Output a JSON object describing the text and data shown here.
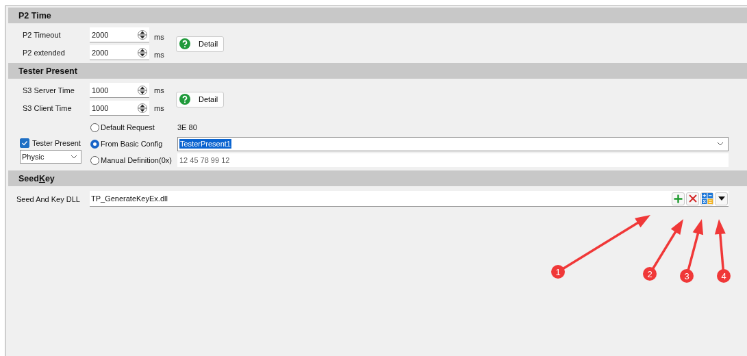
{
  "sections": [
    {
      "title": [
        {
          "text": "P2 Time",
          "underline": false
        }
      ],
      "kind": "timing",
      "rows": [
        {
          "label": "P2 Timeout",
          "value": "2000",
          "unit": "ms"
        },
        {
          "label": "P2 extended",
          "value": "2000",
          "unit": "ms"
        }
      ],
      "detail_button": "Detail"
    },
    {
      "title": [
        {
          "text": "Tester Present",
          "underline": false
        }
      ],
      "kind": "tester",
      "rows": [
        {
          "label": "S3 Server Time",
          "value": "1000",
          "unit": "ms"
        },
        {
          "label": "S3 Client Time",
          "value": "1000",
          "unit": "ms"
        }
      ],
      "detail_button": "Detail",
      "tester_present": {
        "label": "Tester Present",
        "checked": true
      },
      "addressing": {
        "value": "Physic"
      },
      "options": [
        {
          "label": "Default Request",
          "selected": false,
          "kind": "text",
          "value": "3E 80"
        },
        {
          "label": "From Basic Config",
          "selected": true,
          "kind": "combo",
          "value": "TesterPresent1"
        },
        {
          "label": "Manual Definition(0x)",
          "selected": false,
          "kind": "field",
          "value": "12 45 78 99 12"
        }
      ]
    },
    {
      "title": [
        {
          "text": "Seed",
          "underline": false
        },
        {
          "text": "K",
          "underline": true
        },
        {
          "text": "ey",
          "underline": false
        }
      ],
      "kind": "seedkey",
      "label": "Seed And Key DLL",
      "value": "TP_GenerateKeyEx.dll"
    }
  ],
  "annotations": [
    {
      "label": "1"
    },
    {
      "label": "2"
    },
    {
      "label": "3"
    },
    {
      "label": "4"
    }
  ]
}
